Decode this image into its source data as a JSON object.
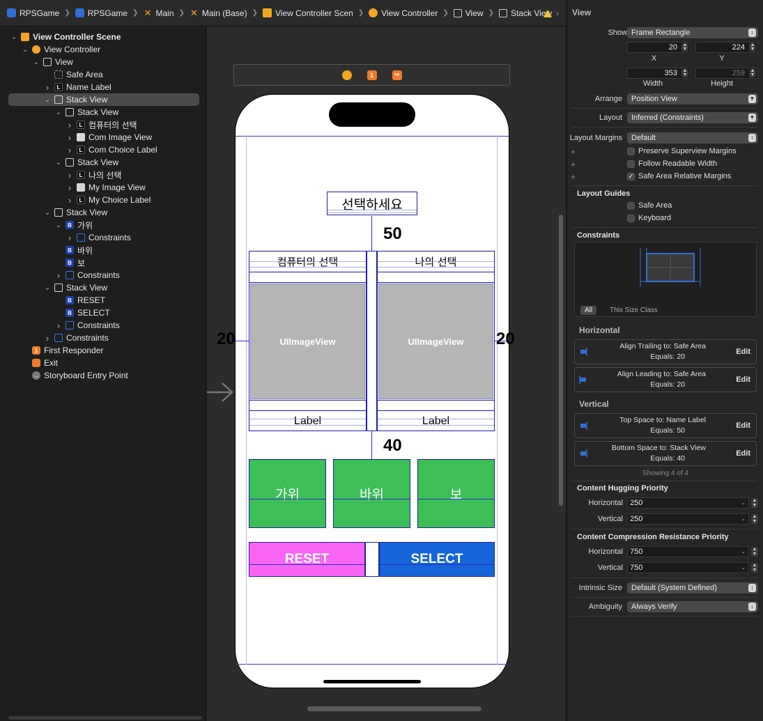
{
  "breadcrumb": {
    "items": [
      {
        "label": "RPSGame",
        "icon": "project-icon"
      },
      {
        "label": "RPSGame",
        "icon": "folder-icon"
      },
      {
        "label": "Main",
        "icon": "storyboard-icon"
      },
      {
        "label": "Main (Base)",
        "icon": "storyboard-icon"
      },
      {
        "label": "View Controller Scen",
        "icon": "scene-icon"
      },
      {
        "label": "View Controller",
        "icon": "view-controller-icon"
      },
      {
        "label": "View",
        "icon": "view-icon"
      },
      {
        "label": "Stack View",
        "icon": "stack-view-icon"
      }
    ]
  },
  "outline": {
    "items": [
      {
        "label": "View Controller Scene",
        "icon": "scene-icon",
        "disclosure": "down"
      },
      {
        "label": "View Controller",
        "icon": "view-controller-icon",
        "disclosure": "down"
      },
      {
        "label": "View",
        "icon": "view-icon",
        "disclosure": "down"
      },
      {
        "label": "Safe Area",
        "icon": "safe-area-icon",
        "disclosure": ""
      },
      {
        "label": "Name Label",
        "icon": "label-icon",
        "disclosure": "right"
      },
      {
        "label": "Stack View",
        "icon": "stack-view-icon",
        "disclosure": "down",
        "selected": true
      },
      {
        "label": "Stack View",
        "icon": "stack-view-icon",
        "disclosure": "down"
      },
      {
        "label": "컴퓨터의 선택",
        "icon": "label-icon",
        "disclosure": "right"
      },
      {
        "label": "Com Image View",
        "icon": "image-view-icon",
        "disclosure": "right"
      },
      {
        "label": "Com Choice Label",
        "icon": "label-icon",
        "disclosure": "right"
      },
      {
        "label": "Stack View",
        "icon": "stack-view-icon",
        "disclosure": "down"
      },
      {
        "label": "나의 선택",
        "icon": "label-icon",
        "disclosure": "right"
      },
      {
        "label": "My Image View",
        "icon": "image-view-icon",
        "disclosure": "right"
      },
      {
        "label": "My Choice Label",
        "icon": "label-icon",
        "disclosure": "right"
      },
      {
        "label": "Stack View",
        "icon": "stack-view-icon",
        "disclosure": "down"
      },
      {
        "label": "가위",
        "icon": "button-icon",
        "disclosure": "down"
      },
      {
        "label": "Constraints",
        "icon": "constraints-icon",
        "disclosure": "right"
      },
      {
        "label": "바위",
        "icon": "button-icon",
        "disclosure": ""
      },
      {
        "label": "보",
        "icon": "button-icon",
        "disclosure": ""
      },
      {
        "label": "Constraints",
        "icon": "constraints-icon",
        "disclosure": "right"
      },
      {
        "label": "Stack View",
        "icon": "stack-view-icon",
        "disclosure": "down"
      },
      {
        "label": "RESET",
        "icon": "button-icon",
        "disclosure": ""
      },
      {
        "label": "SELECT",
        "icon": "button-icon",
        "disclosure": ""
      },
      {
        "label": "Constraints",
        "icon": "constraints-icon",
        "disclosure": "right"
      },
      {
        "label": "Constraints",
        "icon": "constraints-icon",
        "disclosure": "right"
      },
      {
        "label": "First Responder",
        "icon": "first-responder-icon",
        "disclosure": ""
      },
      {
        "label": "Exit",
        "icon": "exit-icon",
        "disclosure": ""
      },
      {
        "label": "Storyboard Entry Point",
        "icon": "entry-point-icon",
        "disclosure": ""
      }
    ]
  },
  "canvas": {
    "name_label": "선택하세요",
    "top_constant": "50",
    "bottom_constant": "40",
    "leading_constant": "20",
    "trailing_constant": "20",
    "com_title": "컴퓨터의 선택",
    "my_title": "나의 선택",
    "image_placeholder": "UIImageView",
    "com_label": "Label",
    "my_label": "Label",
    "buttons": {
      "scissors": "가위",
      "rock": "바위",
      "paper": "보"
    },
    "reset": "RESET",
    "select": "SELECT",
    "colors": {
      "green": "#3dbf57",
      "reset": "#f865f4",
      "select": "#1565d8",
      "image": "#b5b5b5"
    }
  },
  "inspector": {
    "title": "View",
    "show_label": "Show",
    "show_value": "Frame Rectangle",
    "x_value": "20",
    "x_label": "X",
    "y_value": "224",
    "y_label": "Y",
    "width_value": "353",
    "width_label": "Width",
    "height_value": "259",
    "height_label": "Height",
    "arrange_label": "Arrange",
    "arrange_value": "Position View",
    "layout_label": "Layout",
    "layout_value": "Inferred (Constraints)",
    "margins_label": "Layout Margins",
    "margins_value": "Default",
    "preserve_label": "Preserve Superview Margins",
    "readable_label": "Follow Readable Width",
    "safe_relative_label": "Safe Area Relative Margins",
    "layout_guides_title": "Layout Guides",
    "safe_area_label": "Safe Area",
    "keyboard_label": "Keyboard",
    "constraints_title": "Constraints",
    "tab_all": "All",
    "tab_size_class": "This Size Class",
    "horizontal_title": "Horizontal",
    "vertical_title": "Vertical",
    "constraints": [
      {
        "line1": "Align Trailing to:  Safe Area",
        "line2": "Equals:  20",
        "edit": "Edit",
        "icon": "align-trailing-icon"
      },
      {
        "line1": "Align Leading to:  Safe Area",
        "line2": "Equals:  20",
        "edit": "Edit",
        "icon": "align-leading-icon"
      },
      {
        "line1": "Top Space to:  Name Label",
        "line2": "Equals:  50",
        "edit": "Edit",
        "icon": "top-space-icon"
      },
      {
        "line1": "Bottom Space to:  Stack View",
        "line2": "Equals:  40",
        "edit": "Edit",
        "icon": "bottom-space-icon"
      }
    ],
    "showing": "Showing 4 of 4",
    "hugging_title": "Content Hugging Priority",
    "hugging_h_label": "Horizontal",
    "hugging_h_value": "250",
    "hugging_v_label": "Vertical",
    "hugging_v_value": "250",
    "compression_title": "Content Compression Resistance Priority",
    "compression_h_label": "Horizontal",
    "compression_h_value": "750",
    "compression_v_label": "Vertical",
    "compression_v_value": "750",
    "intrinsic_label": "Intrinsic Size",
    "intrinsic_value": "Default (System Defined)",
    "ambiguity_label": "Ambiguity",
    "ambiguity_value": "Always Verify"
  }
}
